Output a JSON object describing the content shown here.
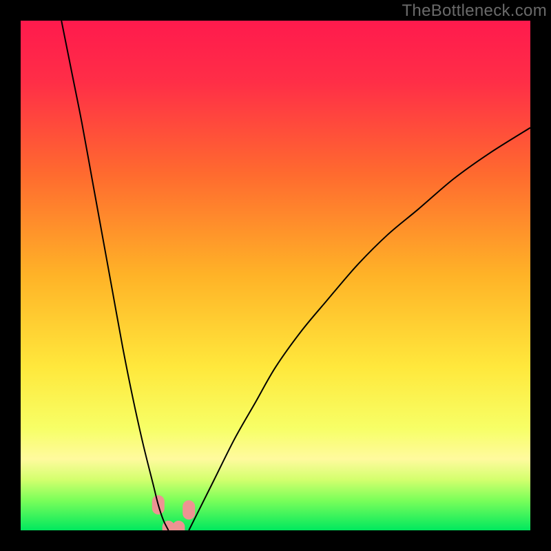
{
  "watermark": "TheBottleneck.com",
  "chart_data": {
    "type": "line",
    "title": "",
    "xlabel": "",
    "ylabel": "",
    "xlim": [
      0,
      100
    ],
    "ylim": [
      0,
      100
    ],
    "grid": false,
    "legend": false,
    "description": "Bottleneck curve: two branches descending to an optimal (near-zero) point around x≈28–33, over a vertical red→green gradient (red=high bottleneck, green=balanced).",
    "series": [
      {
        "name": "left-branch",
        "x": [
          8,
          10,
          12,
          14,
          16,
          18,
          20,
          22,
          24,
          26,
          27,
          28,
          29
        ],
        "y": [
          100,
          90,
          80,
          69,
          58,
          47,
          36,
          26,
          17,
          9,
          5,
          2,
          0
        ]
      },
      {
        "name": "right-branch",
        "x": [
          33,
          35,
          38,
          42,
          46,
          50,
          55,
          60,
          66,
          72,
          78,
          85,
          92,
          100
        ],
        "y": [
          0,
          4,
          10,
          18,
          25,
          32,
          39,
          45,
          52,
          58,
          63,
          69,
          74,
          79
        ]
      }
    ],
    "optimal_zone": {
      "x": [
        27,
        29,
        31,
        33
      ],
      "y": [
        5,
        0,
        0,
        4
      ]
    },
    "gradient_stops": [
      {
        "pct": 0,
        "color": "#ff1a4d"
      },
      {
        "pct": 12,
        "color": "#ff2e47"
      },
      {
        "pct": 30,
        "color": "#ff6a2f"
      },
      {
        "pct": 50,
        "color": "#ffb327"
      },
      {
        "pct": 68,
        "color": "#ffe83c"
      },
      {
        "pct": 80,
        "color": "#f7ff66"
      },
      {
        "pct": 86,
        "color": "#fffa9e"
      },
      {
        "pct": 90,
        "color": "#d4ff6e"
      },
      {
        "pct": 94,
        "color": "#7dff5a"
      },
      {
        "pct": 100,
        "color": "#00e85e"
      }
    ],
    "colors": {
      "curve": "#000000",
      "marker": "#ed9393",
      "frame": "#000000"
    }
  }
}
